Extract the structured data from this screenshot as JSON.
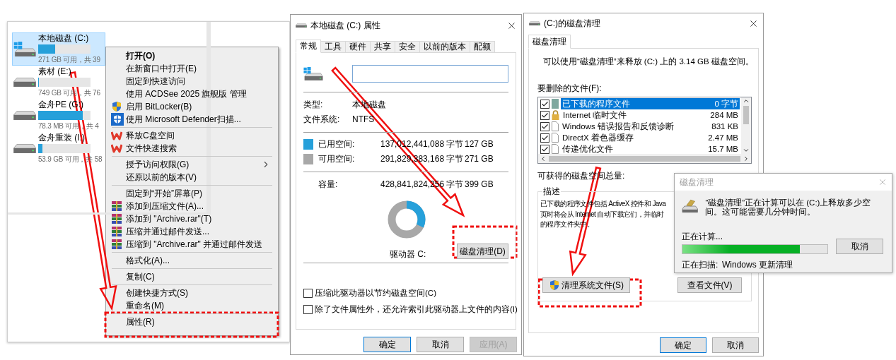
{
  "explorer": {
    "drives": [
      {
        "name": "本地磁盘 (C:)",
        "free": "271 GB 可用，共 39",
        "level": 0.32,
        "selected": true,
        "kind": "system"
      },
      {
        "name": "素材 (E:)",
        "free": "749 GB 可用，共 76",
        "level": 0.02,
        "selected": false,
        "kind": "data"
      },
      {
        "name": "金舟PE (G:)",
        "free": "78.3 MB 可用，共 4",
        "level": 0.85,
        "selected": false,
        "kind": "data"
      },
      {
        "name": "金舟重装 (I:)",
        "free": "53.9 GB 可用，共 58",
        "level": 0.08,
        "selected": false,
        "kind": "data"
      }
    ]
  },
  "context_menu": {
    "items": [
      {
        "kind": "default",
        "label": "打开(O)"
      },
      {
        "kind": "item",
        "label": "在新窗口中打开(E)"
      },
      {
        "kind": "item",
        "label": "固定到快速访问"
      },
      {
        "kind": "item",
        "label": "使用 ACDSee 2025 旗舰版 管理"
      },
      {
        "kind": "item",
        "label": "启用 BitLocker(B)"
      },
      {
        "kind": "item",
        "label": "使用 Microsoft Defender扫描..."
      },
      {
        "kind": "separator"
      },
      {
        "kind": "item",
        "label": "释放C盘空间"
      },
      {
        "kind": "item",
        "label": "文件快速搜索"
      },
      {
        "kind": "separator"
      },
      {
        "kind": "submenu",
        "label": "授予访问权限(G)"
      },
      {
        "kind": "item",
        "label": "还原以前的版本(V)"
      },
      {
        "kind": "separator"
      },
      {
        "kind": "item",
        "label": "固定到“开始”屏幕(P)"
      },
      {
        "kind": "item",
        "label": "添加到压缩文件(A)..."
      },
      {
        "kind": "item",
        "label": "添加到 \"Archive.rar\"(T)"
      },
      {
        "kind": "item",
        "label": "压缩并通过邮件发送..."
      },
      {
        "kind": "item",
        "label": "压缩到 \"Archive.rar\" 并通过邮件发送"
      },
      {
        "kind": "separator"
      },
      {
        "kind": "item",
        "label": "格式化(A)..."
      },
      {
        "kind": "separator"
      },
      {
        "kind": "item",
        "label": "复制(C)"
      },
      {
        "kind": "separator"
      },
      {
        "kind": "item",
        "label": "创建快捷方式(S)"
      },
      {
        "kind": "item",
        "label": "重命名(M)"
      },
      {
        "kind": "separator"
      },
      {
        "kind": "item",
        "label": "属性(R)"
      }
    ]
  },
  "properties": {
    "title": "本地磁盘 (C:) 属性",
    "tabs": [
      {
        "label": "常规",
        "selected": true
      },
      {
        "label": "工具",
        "selected": false
      },
      {
        "label": "硬件",
        "selected": false
      },
      {
        "label": "共享",
        "selected": false
      },
      {
        "label": "安全",
        "selected": false
      },
      {
        "label": "以前的版本",
        "selected": false
      },
      {
        "label": "配额",
        "selected": false
      }
    ],
    "type_label": "类型:",
    "type_value": "本地磁盘",
    "fs_label": "文件系统:",
    "fs_value": "NTFS",
    "space": [
      {
        "label": "已用空间:",
        "bytes": "137,012,441,088 字节",
        "size": "127 GB",
        "color": "#26a0da"
      },
      {
        "label": "可用空间:",
        "bytes": "291,829,383,168 字节",
        "size": "271 GB",
        "color": "#a8a8a8"
      }
    ],
    "capacity": {
      "label": "容量:",
      "bytes": "428,841,824,256 字节",
      "size": "399 GB"
    },
    "usage_ring": {
      "level": 0.32
    },
    "drive_label": "驱动器 C:",
    "cleanup_button": "磁盘清理(D)",
    "options": [
      {
        "label": "压缩此驱动器以节约磁盘空间(C)",
        "checked": false
      },
      {
        "label": "除了文件属性外，还允许索引此驱动器上文件的内容(I)",
        "checked": false
      }
    ],
    "buttons": [
      {
        "label": "确定",
        "default": true,
        "disabled": false
      },
      {
        "label": "取消",
        "default": false,
        "disabled": false
      },
      {
        "label": "应用(A)",
        "default": false,
        "disabled": true
      }
    ]
  },
  "cleanup": {
    "title": "(C:)的磁盘清理",
    "tab": "磁盘清理",
    "summary": "可以使用“磁盘清理”来释放  (C:) 上的 3.14 GB 磁盘空间。",
    "files_label": "要删除的文件(F):",
    "files": [
      {
        "name": "已下载的程序文件",
        "size": "0 字节",
        "checked": true,
        "selected": true
      },
      {
        "name": "Internet 临时文件",
        "size": "284 MB",
        "checked": true,
        "selected": false
      },
      {
        "name": "Windows 错误报告和反馈诊断",
        "size": "831 KB",
        "checked": true,
        "selected": false
      },
      {
        "name": "DirectX 着色器缓存",
        "size": "2.47 MB",
        "checked": true,
        "selected": false
      },
      {
        "name": "传递优化文件",
        "size": "15.7 MB",
        "checked": true,
        "selected": false
      }
    ],
    "total_label": "可获得的磁盘空间总量:",
    "description_label": "描述",
    "description_lines": [
      "已下载的程序文件包括 ActiveX 控件和 Java",
      "页时将会从 Internet 自动下载它们，并临时",
      "的程序文件夹中。"
    ],
    "system_button": "清理系统文件(S)",
    "view_button": "查看文件(V)",
    "buttons": [
      {
        "label": "确定",
        "default": true,
        "disabled": false
      },
      {
        "label": "取消",
        "default": false,
        "disabled": false
      }
    ]
  },
  "progress_dialog": {
    "title": "磁盘清理",
    "message": "“磁盘清理”正在计算可以在 (C:)上释放多少空间。这可能需要几分钟时间。",
    "status": "正在计算...",
    "progress": {
      "level": 0.81
    },
    "cancel": "取消",
    "scanning_label": "正在扫描:",
    "scanning_value": "Windows 更新清理"
  }
}
